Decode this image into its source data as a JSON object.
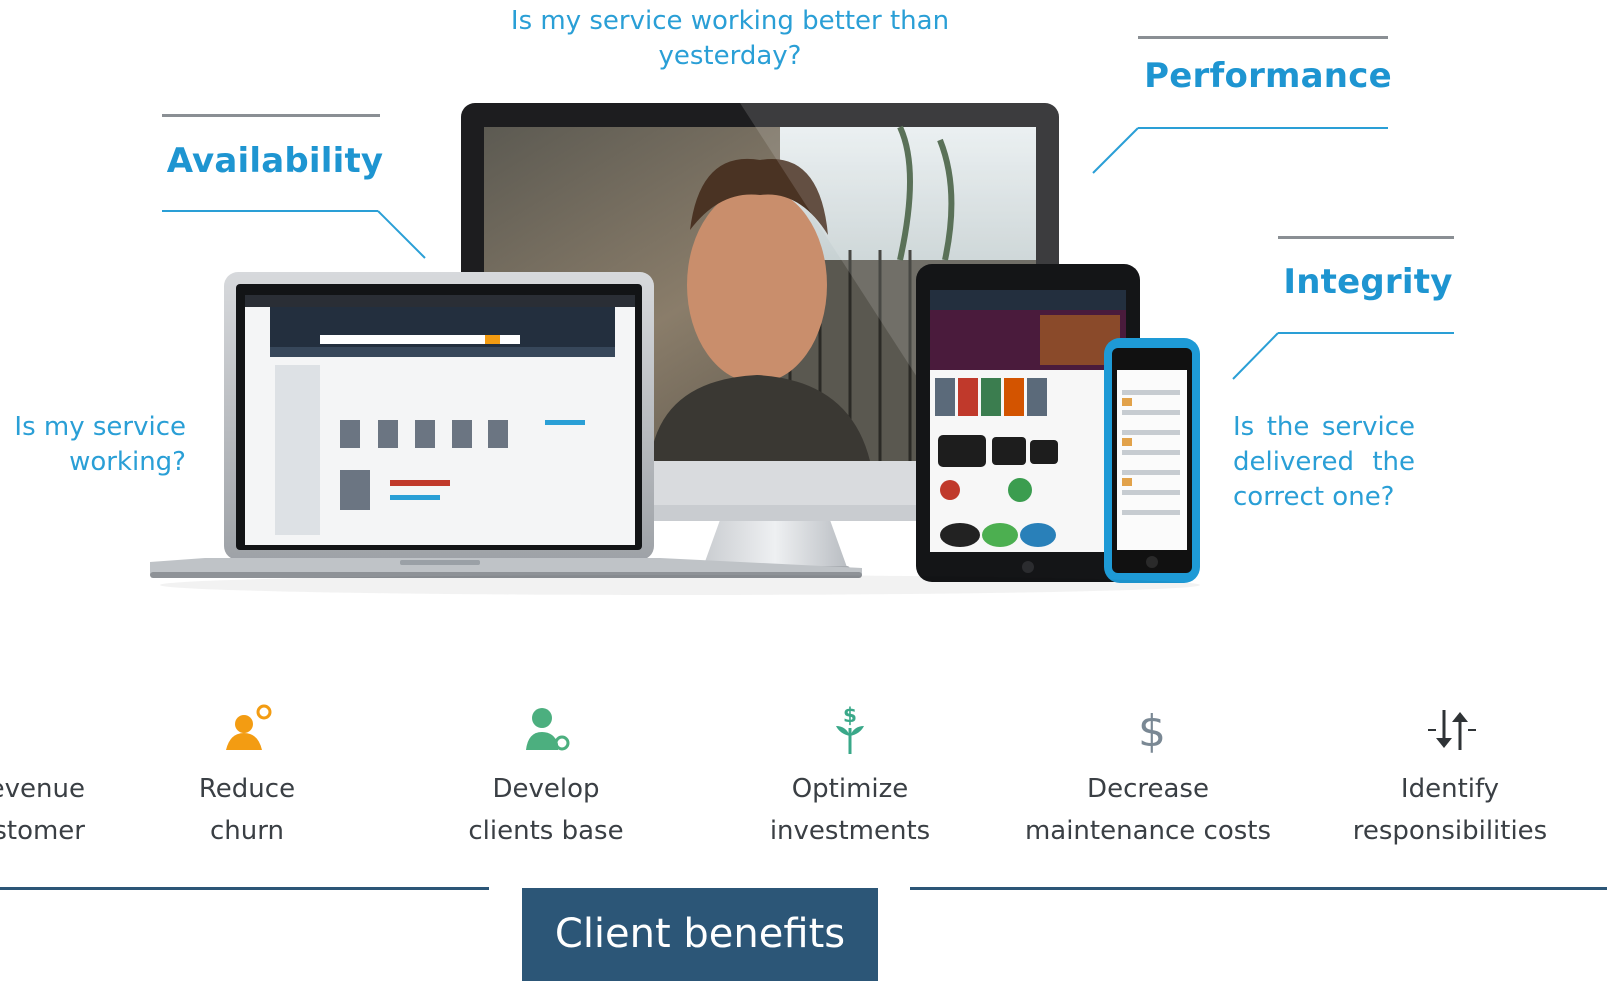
{
  "questions": {
    "top": "Is my service working better than yesterday?",
    "left": "Is my service working?",
    "right": "Is the service delivered the correct one?"
  },
  "headings": {
    "availability": "Availability",
    "performance": "Performance",
    "integrity": "Integrity"
  },
  "benefits": [
    {
      "label": "Increase revenue per customer",
      "icon": "revenue-icon"
    },
    {
      "label": "Reduce churn",
      "icon": "user-churn-icon"
    },
    {
      "label": "Develop clients base",
      "icon": "user-growth-icon"
    },
    {
      "label": "Optimize investments",
      "icon": "dollar-sprout-icon"
    },
    {
      "label": "Decrease maintenance costs",
      "icon": "dollar-icon"
    },
    {
      "label": "Identify responsibilities",
      "icon": "arrows-updown-icon"
    }
  ],
  "footer": {
    "label": "Client benefits"
  },
  "colors": {
    "accent": "#2a9fd6",
    "navy": "#2c5677",
    "green": "#4caf7f",
    "orange": "#f39c12"
  }
}
